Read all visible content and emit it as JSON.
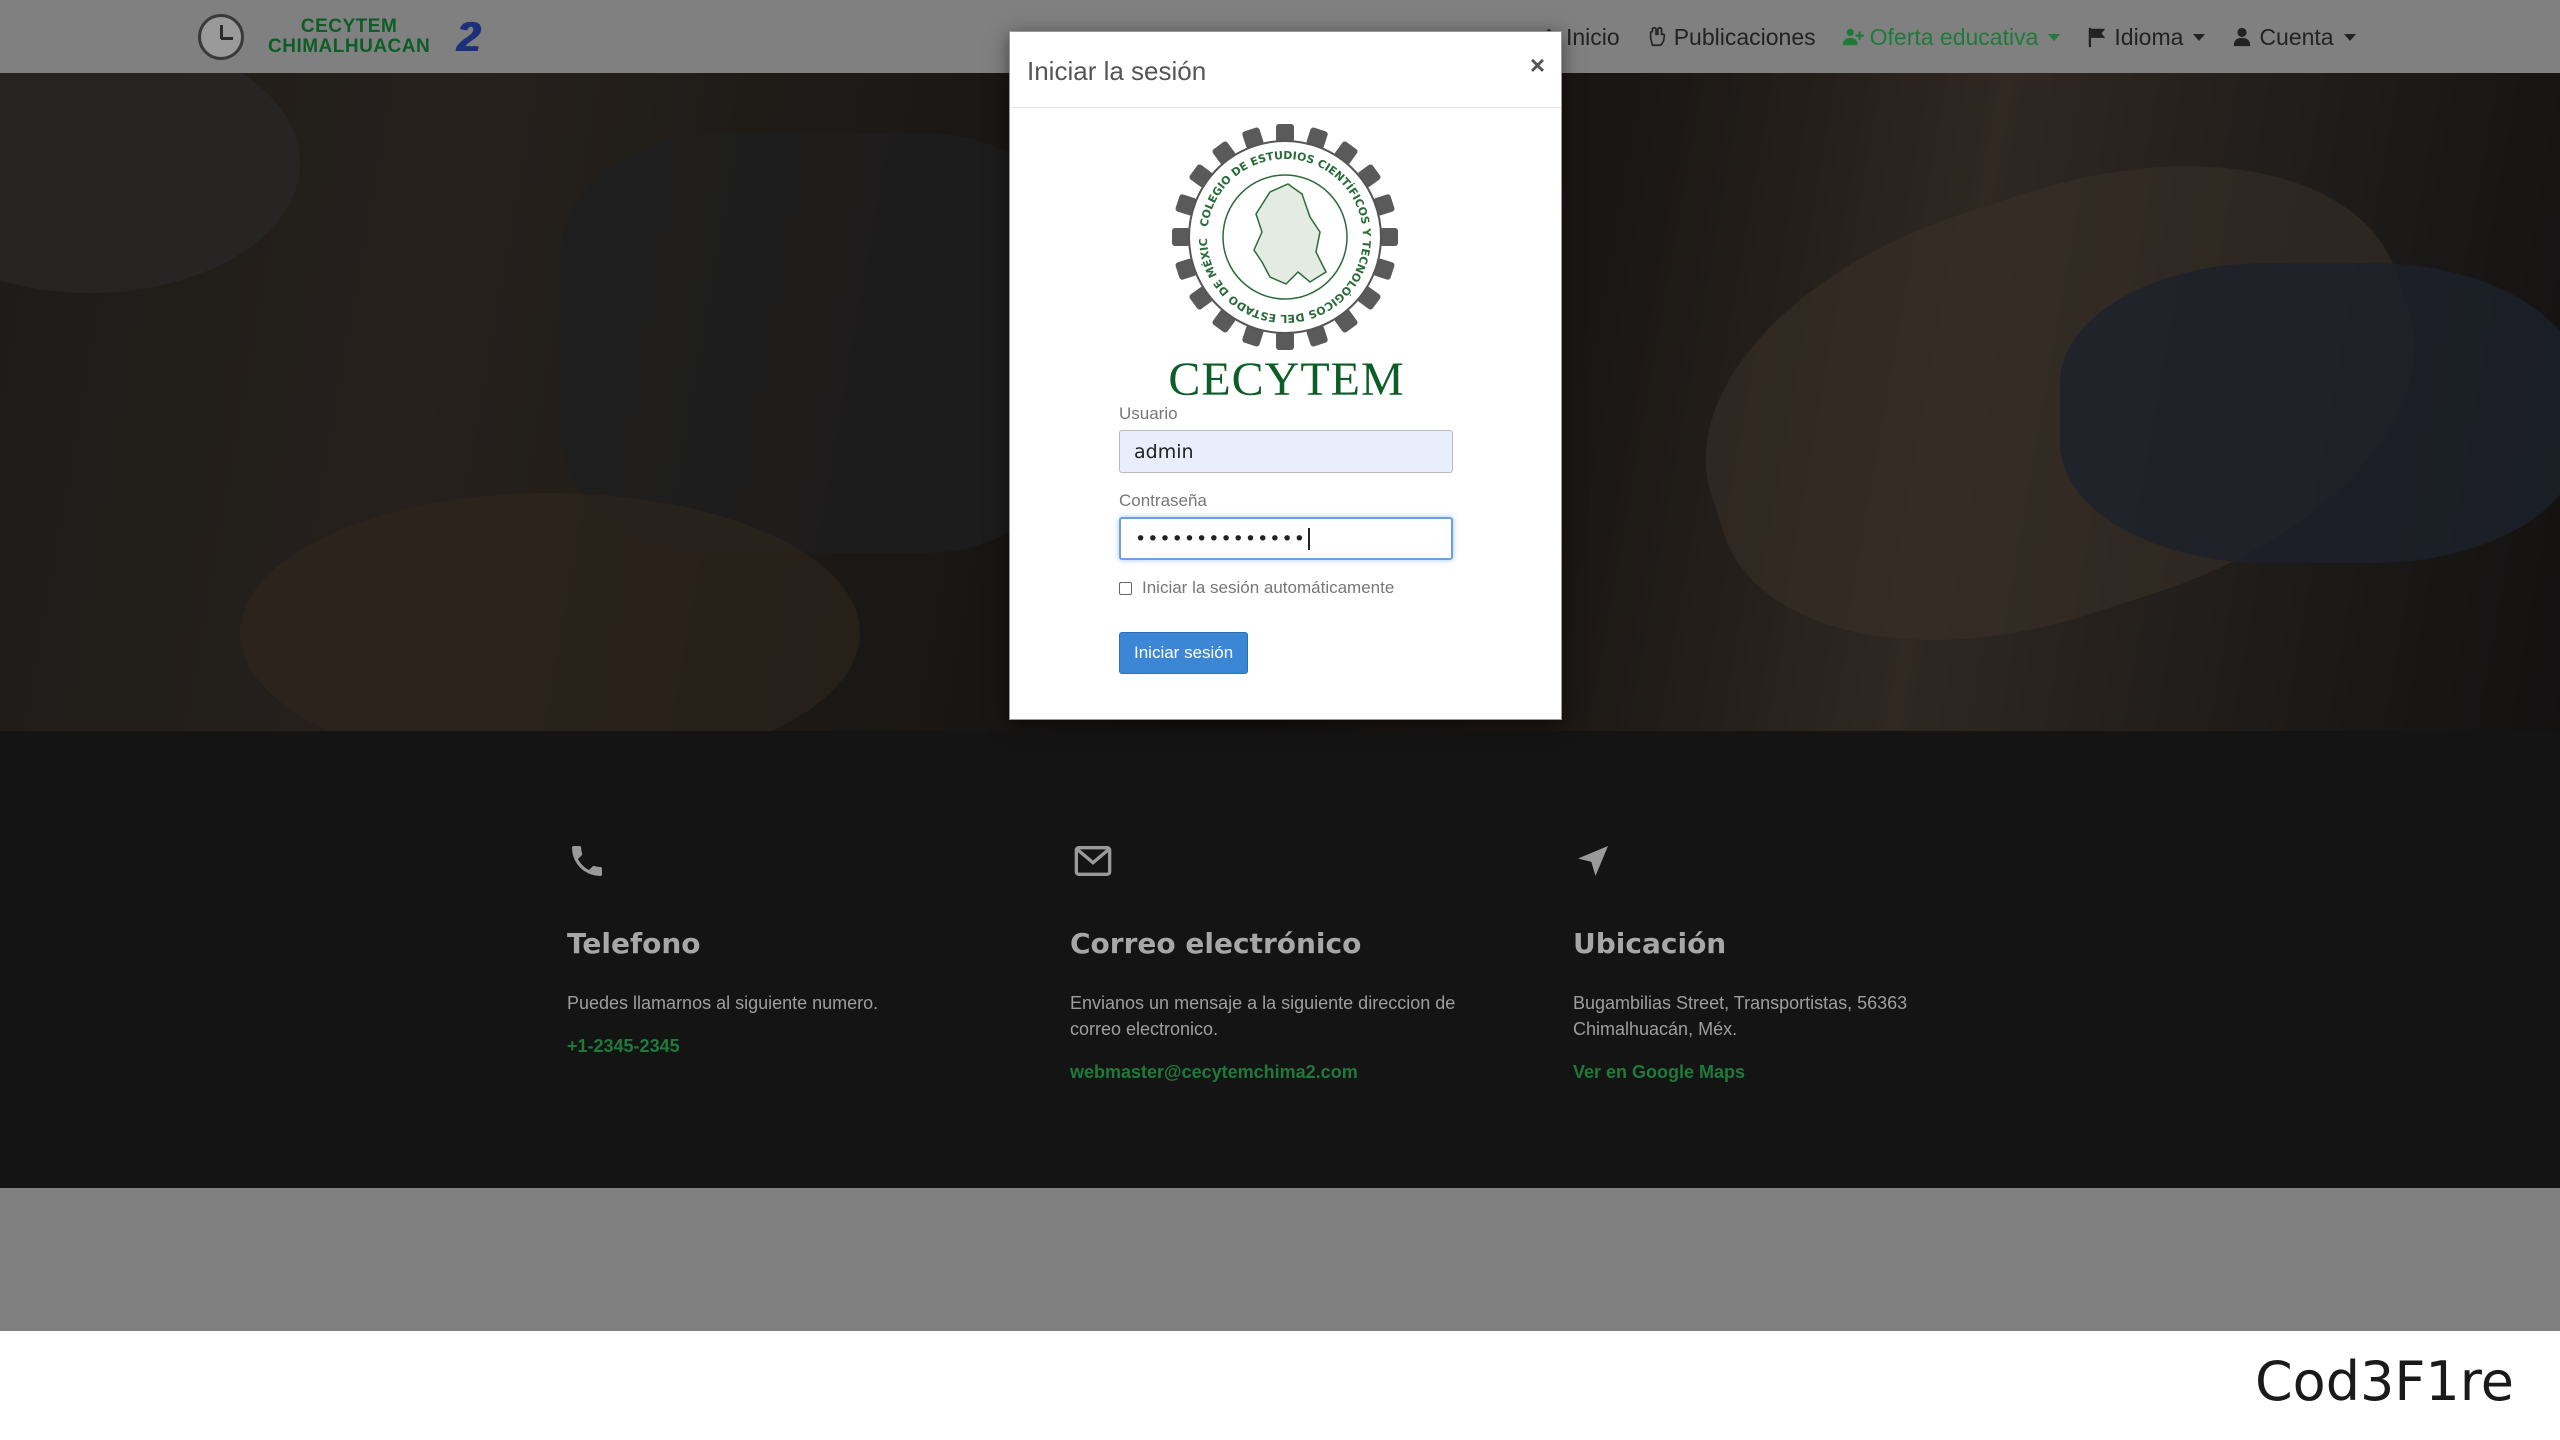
{
  "navbar": {
    "brand_line1": "CECYTEM",
    "brand_line2": "CHIMALHUACAN",
    "brand_mark": "2",
    "items": [
      {
        "label": "Inicio",
        "icon": "home-icon",
        "active": false,
        "dropdown": false
      },
      {
        "label": "Publicaciones",
        "icon": "hand-icon",
        "active": false,
        "dropdown": false
      },
      {
        "label": "Oferta educativa",
        "icon": "user-plus-icon",
        "active": true,
        "dropdown": true
      },
      {
        "label": "Idioma",
        "icon": "flag-icon",
        "active": false,
        "dropdown": true
      },
      {
        "label": "Cuenta",
        "icon": "user-icon",
        "active": false,
        "dropdown": true
      }
    ]
  },
  "modal": {
    "title": "Iniciar la sesión",
    "close": "×",
    "logo_word": "CECYTEM",
    "logo_ring_text": "COLEGIO DE ESTUDIOS CIENTÍFICOS Y TECNOLÓGICOS DEL ESTADO DE MÉXICO",
    "username_label": "Usuario",
    "username_value": "admin",
    "password_label": "Contraseña",
    "password_value": "••••••••••••••",
    "remember_label": "Iniciar la sesión automáticamente",
    "submit_label": "Iniciar sesión"
  },
  "contact": {
    "phone": {
      "title": "Telefono",
      "text": "Puedes llamarnos al siguiente numero.",
      "link": "+1-2345-2345"
    },
    "email": {
      "title": "Correo electrónico",
      "text": "Envianos un mensaje a la siguiente direccion de correo electronico.",
      "link": "webmaster@cecytemchima2.com"
    },
    "location": {
      "title": "Ubicación",
      "text": "Bugambilias Street, Transportistas, 56363 Chimalhuacán, Méx.",
      "link": "Ver en Google Maps"
    }
  },
  "watermark": "Cod3F1re",
  "colors": {
    "accent_green": "#1f7a3a",
    "button_blue": "#3b87d6",
    "navbar_grey": "#808080",
    "footer_dark": "#141414"
  }
}
